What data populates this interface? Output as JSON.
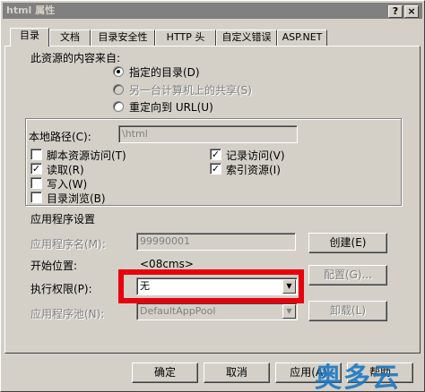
{
  "window": {
    "title": "html 属性",
    "help_glyph": "?",
    "close_glyph": "×"
  },
  "tabs": [
    {
      "label": "目录",
      "active": true
    },
    {
      "label": "文档"
    },
    {
      "label": "目录安全性"
    },
    {
      "label": "HTTP 头"
    },
    {
      "label": "自定义错误"
    },
    {
      "label": "ASP.NET"
    }
  ],
  "source": {
    "heading": "此资源的内容来自:",
    "options": [
      {
        "label": "指定的目录(D)",
        "selected": true,
        "enabled": true
      },
      {
        "label": "另一台计算机上的共享(S)",
        "selected": false,
        "enabled": false
      },
      {
        "label": "重定向到 URL(U)",
        "selected": false,
        "enabled": true
      }
    ]
  },
  "local_path": {
    "label": "本地路径(C):",
    "value": "\\html"
  },
  "permissions": {
    "left": [
      {
        "label": "脚本资源访问(T)",
        "checked": false
      },
      {
        "label": "读取(R)",
        "checked": true
      },
      {
        "label": "写入(W)",
        "checked": false
      },
      {
        "label": "目录浏览(B)",
        "checked": false
      }
    ],
    "right": [
      {
        "label": "记录访问(V)",
        "checked": true
      },
      {
        "label": "索引资源(I)",
        "checked": true
      }
    ]
  },
  "app_settings": {
    "heading": "应用程序设置",
    "app_name_label": "应用程序名(M):",
    "app_name_value": "99990001",
    "create_button": "创建(E)",
    "start_label": "开始位置:",
    "start_value": "<08cms>",
    "config_button": "配置(G)...",
    "exec_label": "执行权限(P):",
    "exec_value": "无",
    "pool_label": "应用程序池(N):",
    "pool_value": "DefaultAppPool",
    "unload_button": "卸载(L)"
  },
  "footer": {
    "ok": "确定",
    "cancel": "取消",
    "apply": "应用(A)",
    "help": "帮助"
  },
  "watermark": "奥多云",
  "colors": {
    "highlight": "#e8000e",
    "title_bar": "#808080",
    "face": "#d4d0c8"
  },
  "check_glyph": "✓",
  "dropdown_glyph": "▼"
}
